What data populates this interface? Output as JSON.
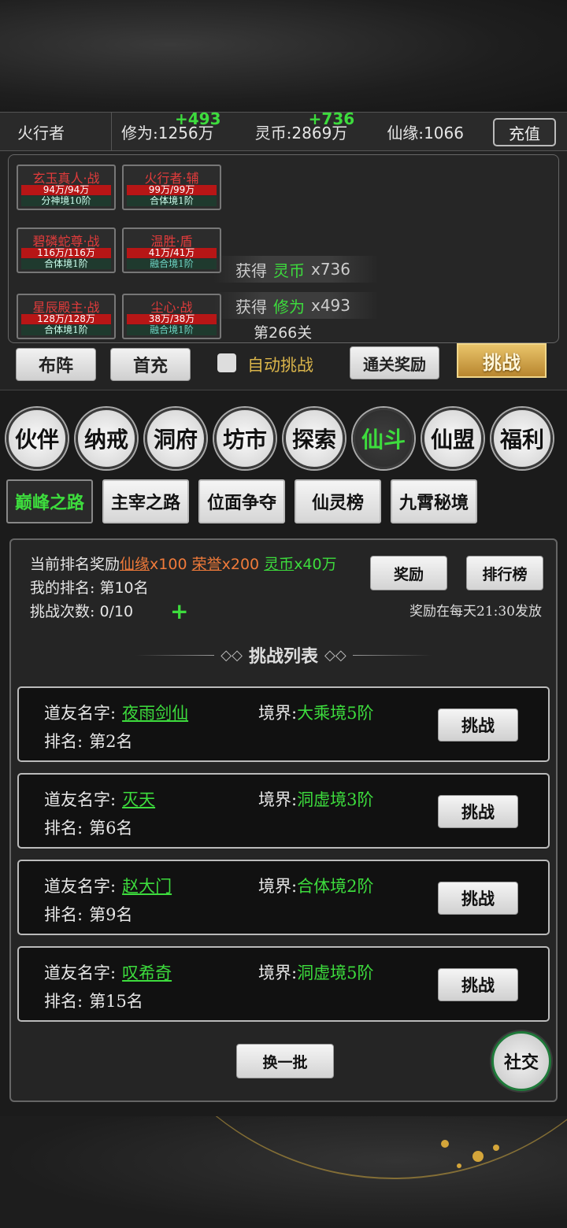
{
  "player": {
    "name": "火行者",
    "cultivation_label": "修为:",
    "cultivation_value": "1256万",
    "cultivation_float": "+493",
    "coin_label": "灵币:",
    "coin_value": "2869万",
    "coin_float": "+736",
    "fate_label": "仙缘:",
    "fate_value": "1066",
    "recharge": "充值"
  },
  "battle": {
    "units": [
      {
        "name": "玄玉真人·战",
        "hp": "94万/94万",
        "realm": "分神境10阶"
      },
      {
        "name": "火行者·辅",
        "hp": "99万/99万",
        "realm": "合体境1阶"
      },
      {
        "name": "碧磷蛇尊·战",
        "hp": "116万/116万",
        "realm": "合体境1阶"
      },
      {
        "name": "温胜·盾",
        "hp": "41万/41万",
        "realm": "融合境1阶"
      },
      {
        "name": "星辰殿主·战",
        "hp": "128万/128万",
        "realm": "合体境1阶"
      },
      {
        "name": "尘心·战",
        "hp": "38万/38万",
        "realm": "融合境1阶"
      }
    ],
    "gains": [
      {
        "prefix": "获得",
        "item": "灵币",
        "qty": "x736"
      },
      {
        "prefix": "获得",
        "item": "修为",
        "qty": "x493"
      }
    ],
    "stage": "第266关",
    "buttons": {
      "formation": "布阵",
      "first_charge": "首充",
      "auto_label": "自动挑战",
      "clear_reward": "通关奖励",
      "challenge": "挑战"
    }
  },
  "menu": [
    "伙伴",
    "纳戒",
    "洞府",
    "坊市",
    "探索",
    "仙斗",
    "仙盟",
    "福利"
  ],
  "menu_active": "仙斗",
  "tabs": [
    "巅峰之路",
    "主宰之路",
    "位面争夺",
    "仙灵榜",
    "九霄秘境"
  ],
  "tab_active": "巅峰之路",
  "panel": {
    "reward_label": "当前排名奖励",
    "rewards": [
      {
        "name": "仙缘",
        "qty": "x100"
      },
      {
        "name": "荣誉",
        "qty": "x200"
      },
      {
        "name": "灵币",
        "qty": "x40万"
      }
    ],
    "my_rank_label": "我的排名:",
    "my_rank_value": "第10名",
    "attempts_label": "挑战次数:",
    "attempts_value": "0/10",
    "reward_button": "奖励",
    "leaderboard_button": "排行榜",
    "reward_time": "奖励在每天21:30发放",
    "list_title": "挑战列表",
    "name_label": "道友名字:",
    "realm_label": "境界:",
    "rank_label": "排名:",
    "challenge_button": "挑战",
    "opponents": [
      {
        "name": "夜雨剑仙",
        "realm": "大乘境5阶",
        "rank": "第2名"
      },
      {
        "name": "灭天",
        "realm": "洞虚境3阶",
        "rank": "第6名"
      },
      {
        "name": "赵大门",
        "realm": "合体境2阶",
        "rank": "第9名"
      },
      {
        "name": "叹希奇",
        "realm": "洞虚境5阶",
        "rank": "第15名"
      }
    ],
    "refresh_button": "换一批"
  },
  "social_button": "社交",
  "colors": {
    "highlight_green": "#3ddc3d",
    "reward_orange": "#f07a3a",
    "enemy_red": "#e23b3b",
    "gold": "#d9b44a"
  }
}
